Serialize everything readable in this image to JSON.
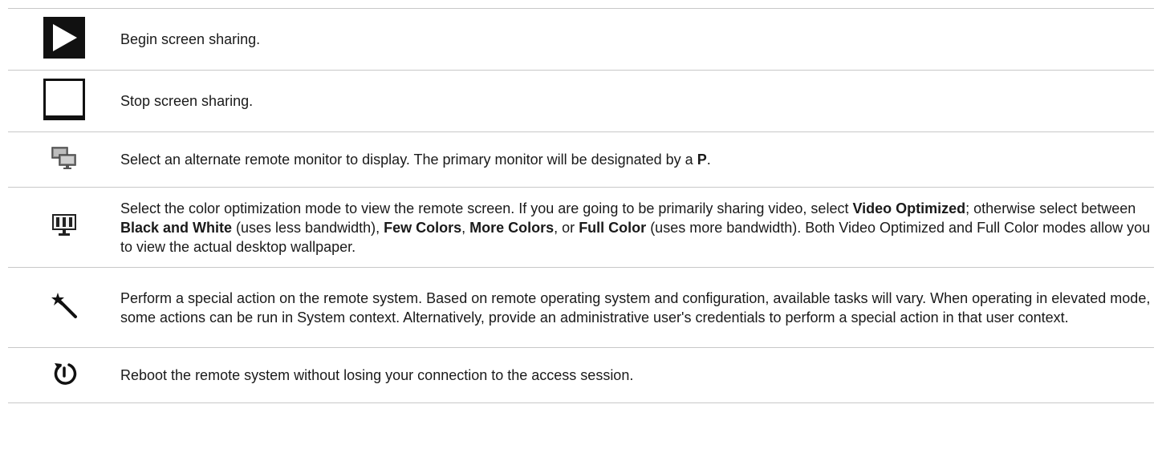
{
  "rows": [
    {
      "icon": "play-icon",
      "parts": [
        {
          "text": "Begin screen sharing.",
          "bold": false
        }
      ]
    },
    {
      "icon": "stop-icon",
      "parts": [
        {
          "text": "Stop screen sharing.",
          "bold": false
        }
      ]
    },
    {
      "icon": "monitors-icon",
      "parts": [
        {
          "text": "Select an alternate remote monitor to display. The primary monitor will be designated by a ",
          "bold": false
        },
        {
          "text": "P",
          "bold": true
        },
        {
          "text": ".",
          "bold": false
        }
      ]
    },
    {
      "icon": "color-mode-icon",
      "parts": [
        {
          "text": "Select the color optimization mode to view the remote screen. If you are going to be primarily sharing video, select ",
          "bold": false
        },
        {
          "text": "Video Optimized",
          "bold": true
        },
        {
          "text": "; otherwise select between ",
          "bold": false
        },
        {
          "text": "Black and White",
          "bold": true
        },
        {
          "text": " (uses less bandwidth), ",
          "bold": false
        },
        {
          "text": "Few Colors",
          "bold": true
        },
        {
          "text": ", ",
          "bold": false
        },
        {
          "text": "More Colors",
          "bold": true
        },
        {
          "text": ", or ",
          "bold": false
        },
        {
          "text": "Full Color",
          "bold": true
        },
        {
          "text": " (uses more bandwidth). Both Video Optimized and Full Color modes allow you to view the actual desktop wallpaper.",
          "bold": false
        }
      ]
    },
    {
      "icon": "magic-wand-icon",
      "parts": [
        {
          "text": "Perform a special action on the remote system. Based on remote operating system and configuration, available tasks will vary. When operating in elevated mode, some actions can be run in System context. Alternatively, provide an administrative user's credentials to perform a special action in that user context.",
          "bold": false
        }
      ]
    },
    {
      "icon": "reboot-icon",
      "parts": [
        {
          "text": "Reboot the remote system without losing your connection to the access session.",
          "bold": false
        }
      ]
    }
  ]
}
